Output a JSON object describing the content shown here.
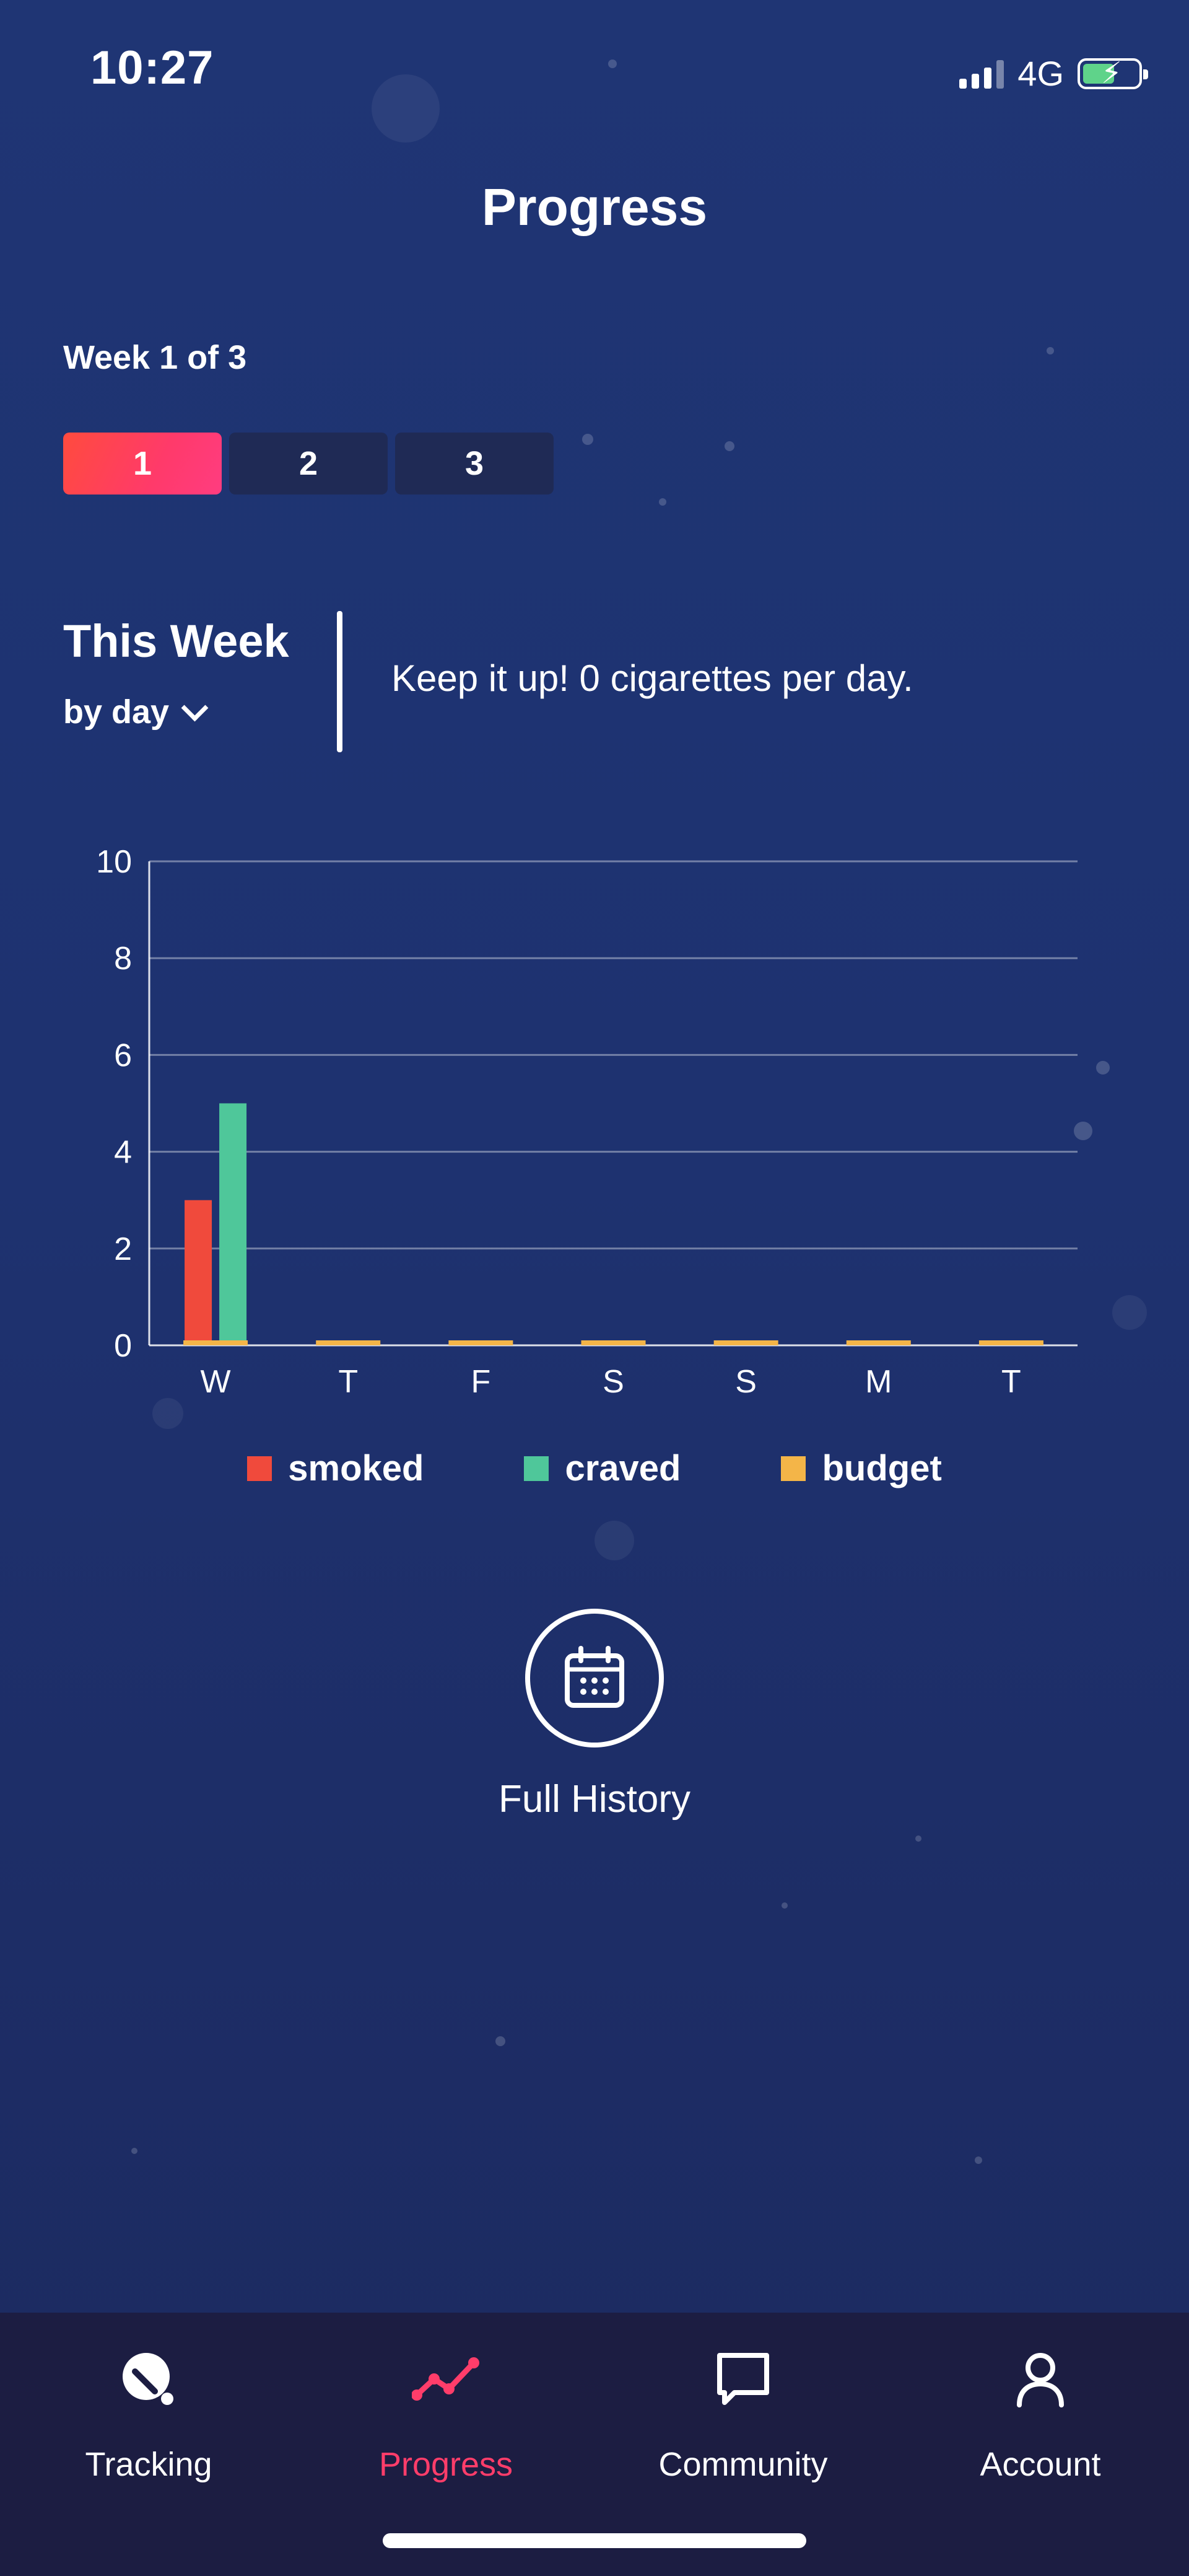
{
  "status_bar": {
    "time": "10:27",
    "network": "4G"
  },
  "page": {
    "title": "Progress"
  },
  "week": {
    "label": "Week 1 of 3",
    "tabs": [
      {
        "label": "1",
        "active": true
      },
      {
        "label": "2",
        "active": false
      },
      {
        "label": "3",
        "active": false
      }
    ]
  },
  "summary": {
    "heading": "This Week",
    "period_selector": "by day",
    "message": "Keep it up! 0 cigarettes per day."
  },
  "chart_data": {
    "type": "bar",
    "categories": [
      "W",
      "T",
      "F",
      "S",
      "S",
      "M",
      "T"
    ],
    "series": [
      {
        "name": "smoked",
        "color": "#f04a3c",
        "values": [
          3,
          0,
          0,
          0,
          0,
          0,
          0
        ]
      },
      {
        "name": "craved",
        "color": "#4fc79a",
        "values": [
          5,
          0,
          0,
          0,
          0,
          0,
          0
        ]
      },
      {
        "name": "budget",
        "color": "#f4b548",
        "values": [
          0,
          0,
          0,
          0,
          0,
          0,
          0
        ]
      }
    ],
    "ylim": [
      0,
      10
    ],
    "yticks": [
      0,
      2,
      4,
      6,
      8,
      10
    ],
    "grid": true,
    "legend": "bottom"
  },
  "history": {
    "label": "Full History",
    "icon": "calendar-icon"
  },
  "tabbar": {
    "items": [
      {
        "label": "Tracking",
        "icon": "tracking-icon",
        "active": false
      },
      {
        "label": "Progress",
        "icon": "progress-icon",
        "active": true
      },
      {
        "label": "Community",
        "icon": "chat-icon",
        "active": false
      },
      {
        "label": "Account",
        "icon": "user-icon",
        "active": false
      }
    ]
  },
  "colors": {
    "accent": "#ff3d6a",
    "background": "#1f3574",
    "tabbar": "#1c1d42"
  }
}
